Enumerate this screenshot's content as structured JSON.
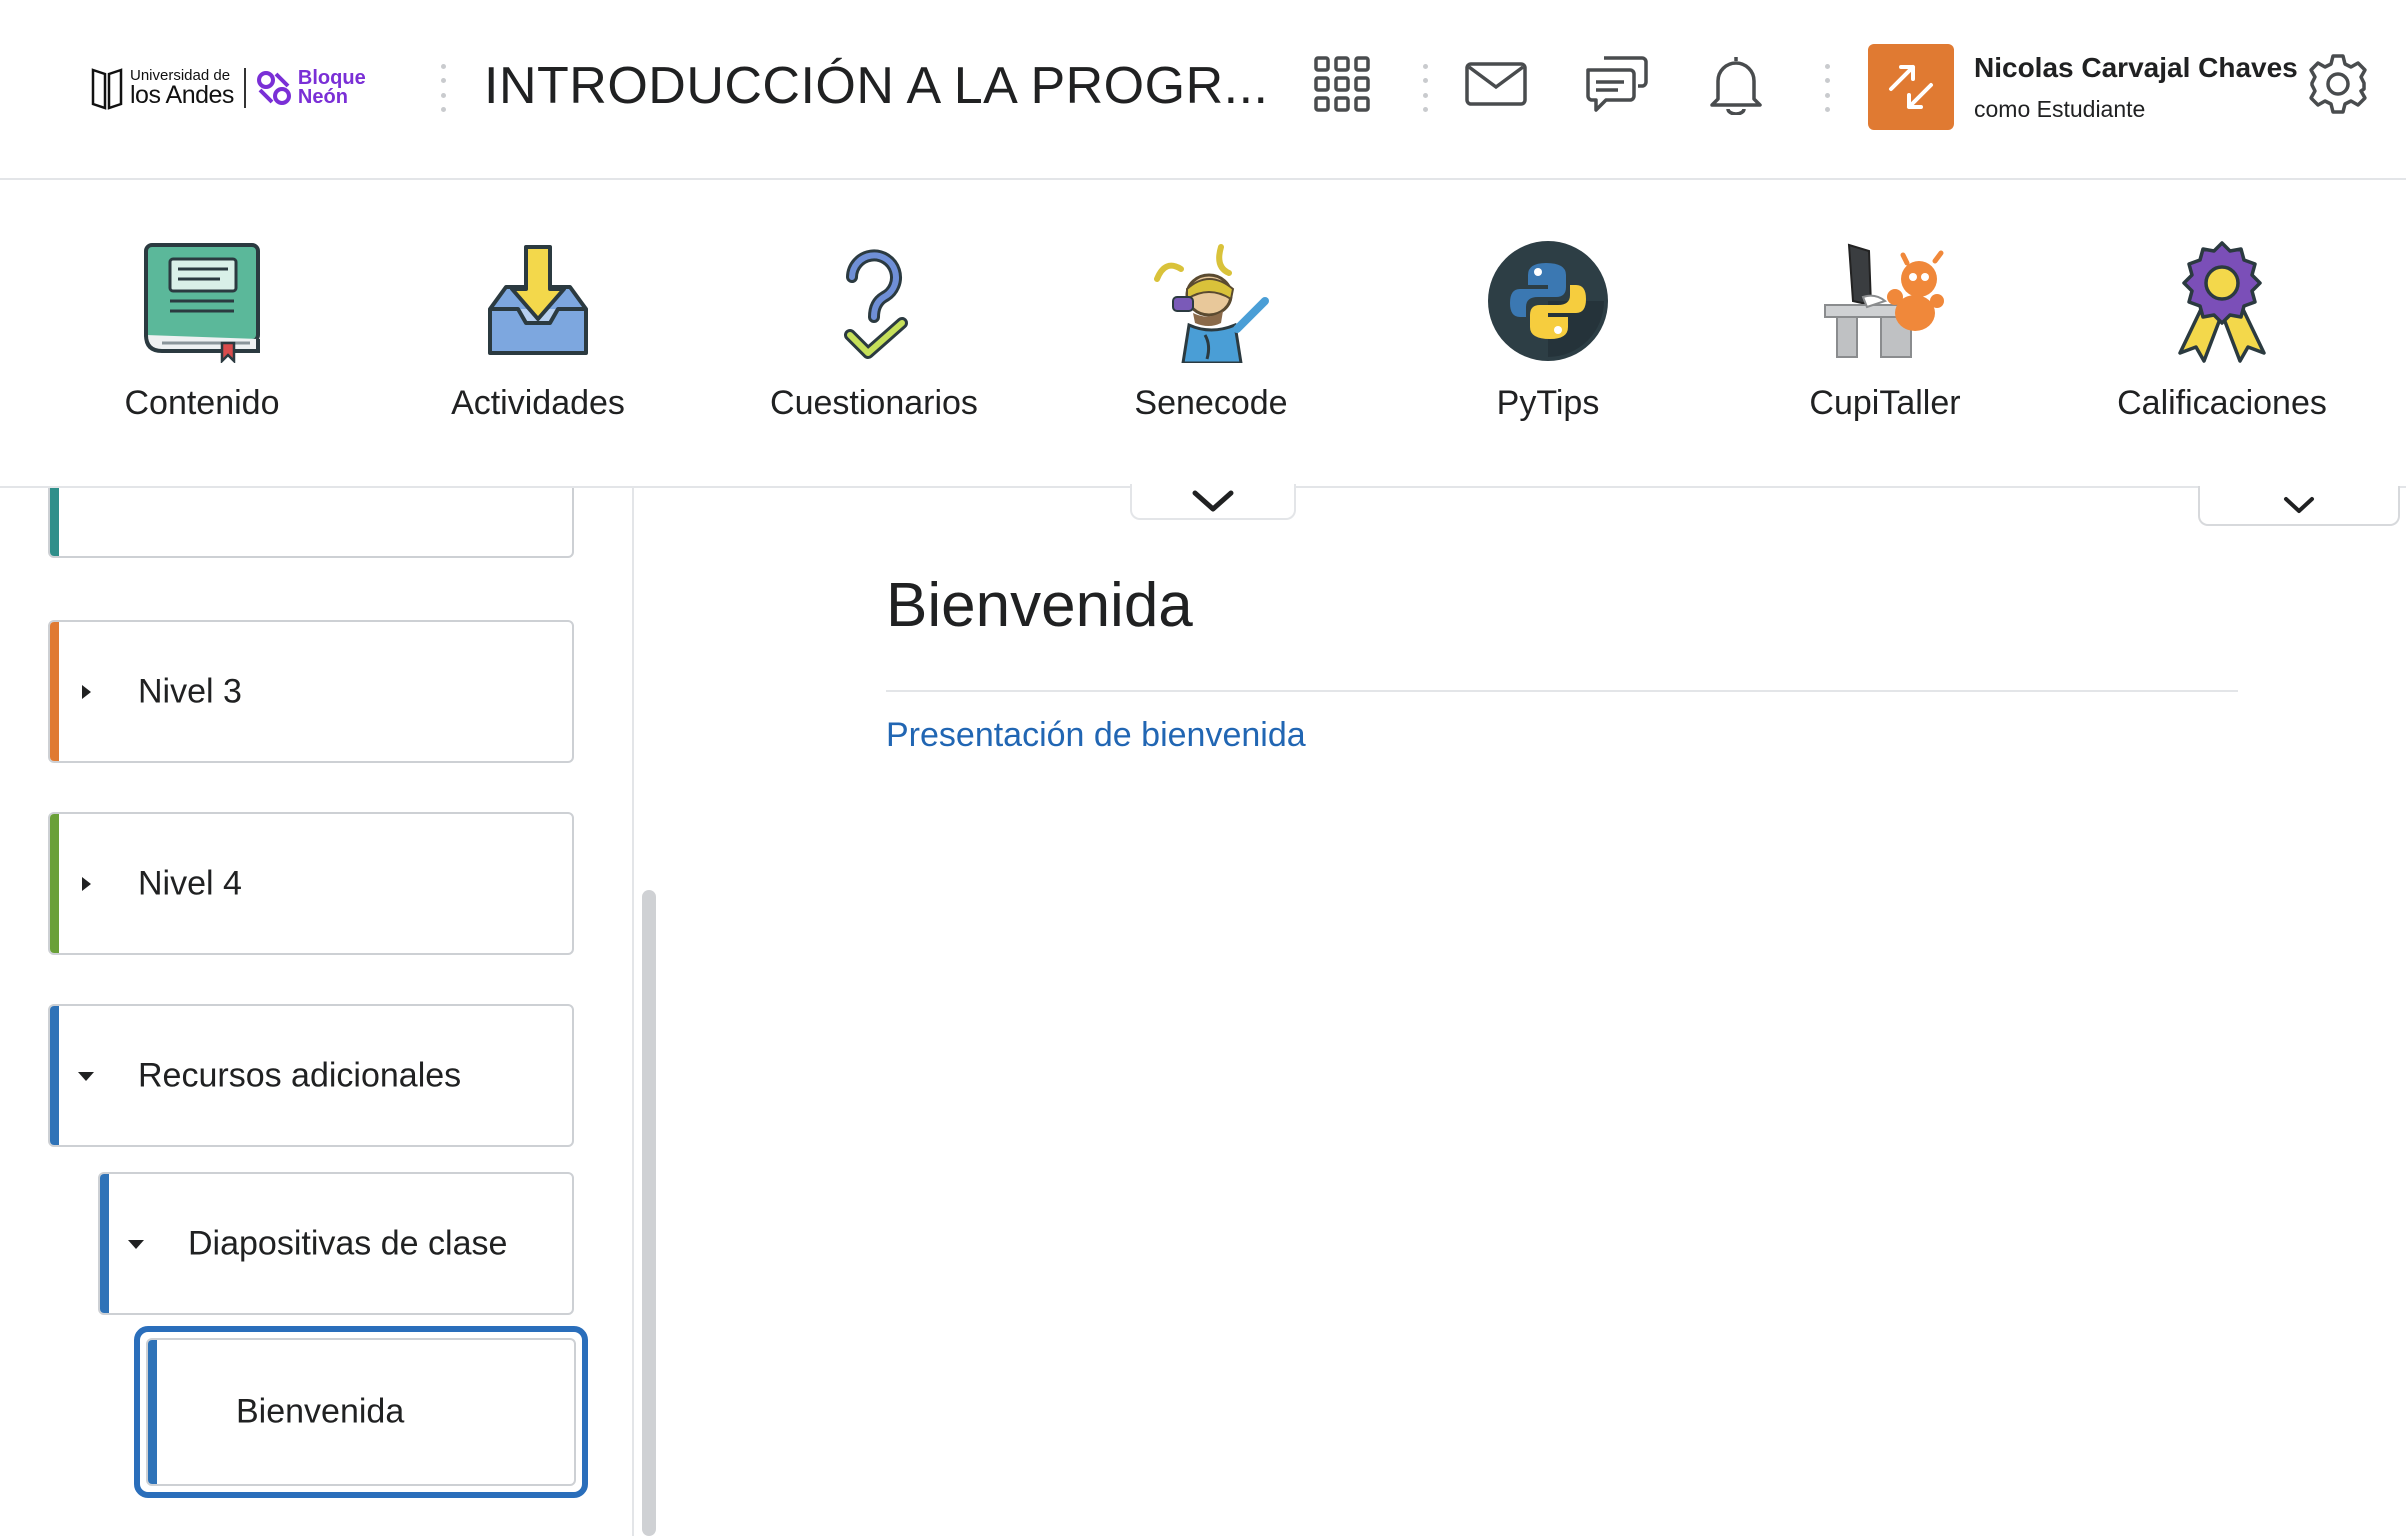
{
  "header": {
    "logo": {
      "university_small": "Universidad de",
      "university_big": "los Andes",
      "neon_line1": "Bloque",
      "neon_line2": "Neón"
    },
    "course_title": "INTRODUCCIÓN A LA PROGR...",
    "icons": [
      "course-selector-grid-icon",
      "mail-icon",
      "chat-icon",
      "bell-icon",
      "settings-icon"
    ],
    "user": {
      "name": "Nicolas Carvajal Chaves",
      "role": "como Estudiante"
    }
  },
  "navbar": {
    "items": [
      {
        "label": "Contenido",
        "icon": "book-icon"
      },
      {
        "label": "Actividades",
        "icon": "inbox-download-icon"
      },
      {
        "label": "Cuestionarios",
        "icon": "question-check-icon"
      },
      {
        "label": "Senecode",
        "icon": "senecode-mascot-icon"
      },
      {
        "label": "PyTips",
        "icon": "python-icon"
      },
      {
        "label": "CupiTaller",
        "icon": "cupitaller-desk-icon"
      },
      {
        "label": "Calificaciones",
        "icon": "award-ribbon-icon"
      }
    ]
  },
  "sidebar": {
    "items": [
      {
        "label": "",
        "color": "#2f8f8a",
        "state": "partial"
      },
      {
        "label": "Nivel 3",
        "color": "#e07a32",
        "state": "collapsed"
      },
      {
        "label": "Nivel 4",
        "color": "#6aa038",
        "state": "collapsed"
      },
      {
        "label": "Recursos adicionales",
        "color": "#2f73b8",
        "state": "expanded"
      },
      {
        "label": "Diapositivas de clase",
        "color": "#2f73b8",
        "state": "expanded"
      },
      {
        "label": "Bienvenida",
        "color": "#2f73b8",
        "state": "selected"
      }
    ]
  },
  "main": {
    "title": "Bienvenida",
    "link": "Presentación de bienvenida"
  },
  "colors": {
    "accent": "#2a6ebb",
    "link": "#2166b3",
    "avatar": "#e07a32",
    "brand_neon": "#7a2fd6"
  }
}
